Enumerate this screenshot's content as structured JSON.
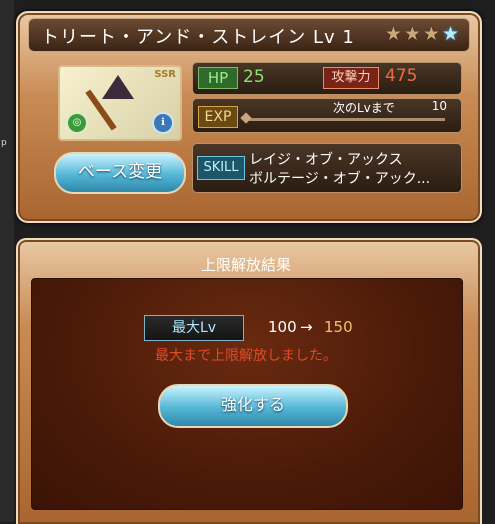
{
  "character": {
    "name_level": "トリート・アンド・ストレイン Lv 1",
    "rarity_badge": "SSR",
    "stars": [
      {
        "icon": "star-icon",
        "style": "gold"
      },
      {
        "icon": "star-icon",
        "style": "gold"
      },
      {
        "icon": "star-icon",
        "style": "gold"
      },
      {
        "icon": "star-icon",
        "style": "blue"
      }
    ]
  },
  "stats": {
    "hp_label": "HP",
    "hp_value": "25",
    "atk_label": "攻撃力",
    "atk_value": "475",
    "exp_label": "EXP",
    "exp_next_label": "次のLvまで",
    "exp_next_value": "10",
    "skill_label": "SKILL",
    "skills": [
      "レイジ・オブ・アックス",
      "ボルテージ・オブ・アック..."
    ]
  },
  "buttons": {
    "base_change": "ベース変更",
    "confirm": "強化する"
  },
  "result": {
    "title": "上限解放結果",
    "max_lv_label": "最大Lv",
    "old_level": "100",
    "arrow": "→",
    "new_level": "150",
    "message": "最大まで上限解放しました。"
  },
  "sidebar": {
    "fragment": "p"
  },
  "colors": {
    "panel_brown": "#a9652f",
    "button_cyan": "#55b6d6",
    "atk_red": "#f26a3c",
    "hp_green": "#8fe070",
    "notice_red": "#e04a28",
    "new_level_gold": "#f3c26a"
  }
}
